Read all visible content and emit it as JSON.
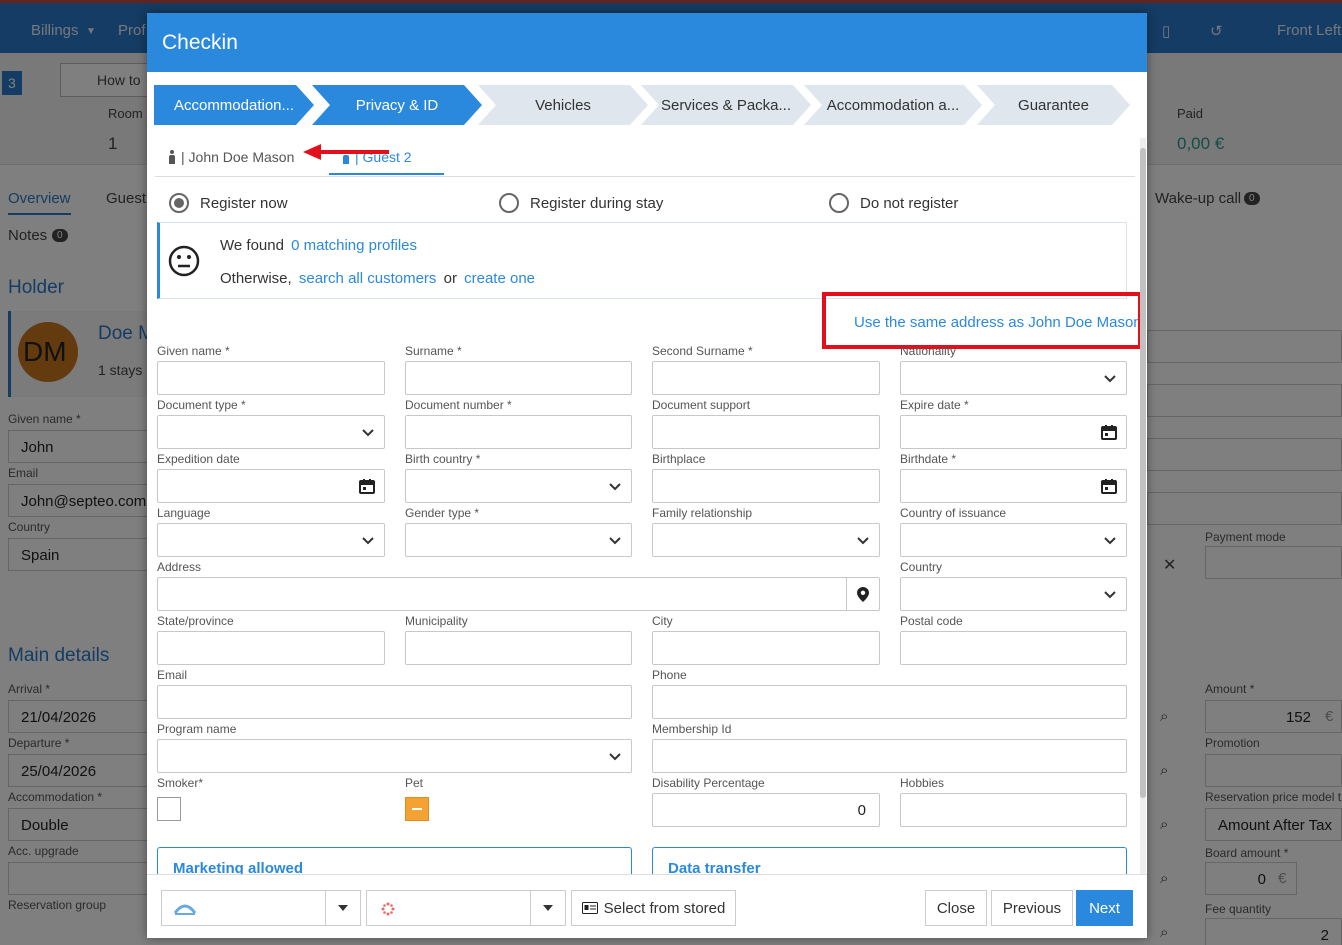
{
  "background": {
    "nav": {
      "billings": "Billings",
      "profile_partial": "Prof",
      "front_left": "Front Left"
    },
    "subbar": {
      "step_partial": "3",
      "howto_partial": "How to",
      "room_label": "Room",
      "room_value": "1",
      "paid_label": "Paid",
      "paid_value": "0,00 €"
    },
    "tabs": {
      "overview": "Overview",
      "guest_partial": "Guest",
      "notes": "Notes",
      "notes_count": "0",
      "wakeup": "Wake-up call",
      "wakeup_count": "0"
    },
    "holder": {
      "title": "Holder",
      "avatar": "DM",
      "name_partial": "Doe M",
      "stays_partial": "1 stays"
    },
    "fields": {
      "given_name_label": "Given name *",
      "given_name": "John",
      "email_label": "Email",
      "email": "John@septeo.com",
      "country_label": "Country",
      "country": "Spain"
    },
    "main_details": {
      "title": "Main details",
      "arrival_label": "Arrival *",
      "arrival": "21/04/2026",
      "departure_label": "Departure *",
      "departure": "25/04/2026",
      "accommodation_label": "Accommodation *",
      "accommodation": "Double",
      "acc_upgrade_label": "Acc. upgrade",
      "reservation_group_label": "Reservation group"
    },
    "right": {
      "payment_mode_label": "Payment mode",
      "amount_label": "Amount *",
      "amount": "152",
      "amount_currency": "€",
      "promotion_label": "Promotion",
      "price_model_label": "Reservation price model t",
      "price_model": "Amount After Tax",
      "board_amount_label": "Board amount *",
      "board_amount": "0",
      "board_currency": "€",
      "fee_quantity_label": "Fee quantity",
      "fee_quantity": "2"
    }
  },
  "modal": {
    "title": "Checkin",
    "steps": [
      {
        "label": "Accommodation...",
        "state": "done"
      },
      {
        "label": "Privacy & ID",
        "state": "active"
      },
      {
        "label": "Vehicles",
        "state": "todo"
      },
      {
        "label": "Services & Packa...",
        "state": "todo"
      },
      {
        "label": "Accommodation a...",
        "state": "todo"
      },
      {
        "label": "Guarantee",
        "state": "todo"
      }
    ],
    "guests": [
      {
        "label": "| John Doe Mason",
        "active": false
      },
      {
        "label": "| Guest 2",
        "active": true
      }
    ],
    "register": {
      "now": "Register now",
      "during": "Register during stay",
      "not": "Do not register",
      "selected": "now"
    },
    "matching": {
      "we_found": "We found",
      "profiles_link": "0 matching profiles",
      "otherwise": "Otherwise,",
      "search_link": "search all customers",
      "or": "or",
      "create_link": "create one"
    },
    "same_address_link": "Use the same address as John Doe Mason",
    "form": {
      "given_name": "Given name *",
      "surname": "Surname *",
      "second_surname": "Second Surname *",
      "nationality": "Nationality",
      "document_type": "Document type *",
      "document_number": "Document number *",
      "document_support": "Document support",
      "expire_date": "Expire date *",
      "expedition_date": "Expedition date",
      "birth_country": "Birth country *",
      "birthplace": "Birthplace",
      "birthdate": "Birthdate *",
      "language": "Language",
      "gender_type": "Gender type *",
      "family_relationship": "Family relationship",
      "country_of_issuance": "Country of issuance",
      "address": "Address",
      "country": "Country",
      "state_province": "State/province",
      "municipality": "Municipality",
      "city": "City",
      "postal_code": "Postal code",
      "email": "Email",
      "phone": "Phone",
      "program_name": "Program name",
      "membership_id": "Membership Id",
      "smoker": "Smoker*",
      "pet": "Pet",
      "disability_percentage": "Disability Percentage",
      "disability_value": "0",
      "hobbies": "Hobbies"
    },
    "sections": {
      "marketing": "Marketing allowed",
      "data_transfer": "Data transfer"
    },
    "footer": {
      "select_stored": "Select from stored",
      "close": "Close",
      "previous": "Previous",
      "next": "Next"
    }
  },
  "colors": {
    "primary": "#2b89dd",
    "highlight_box": "#e3101c",
    "arrow": "#e3101c",
    "pet_indeterminate": "#f5a234"
  }
}
